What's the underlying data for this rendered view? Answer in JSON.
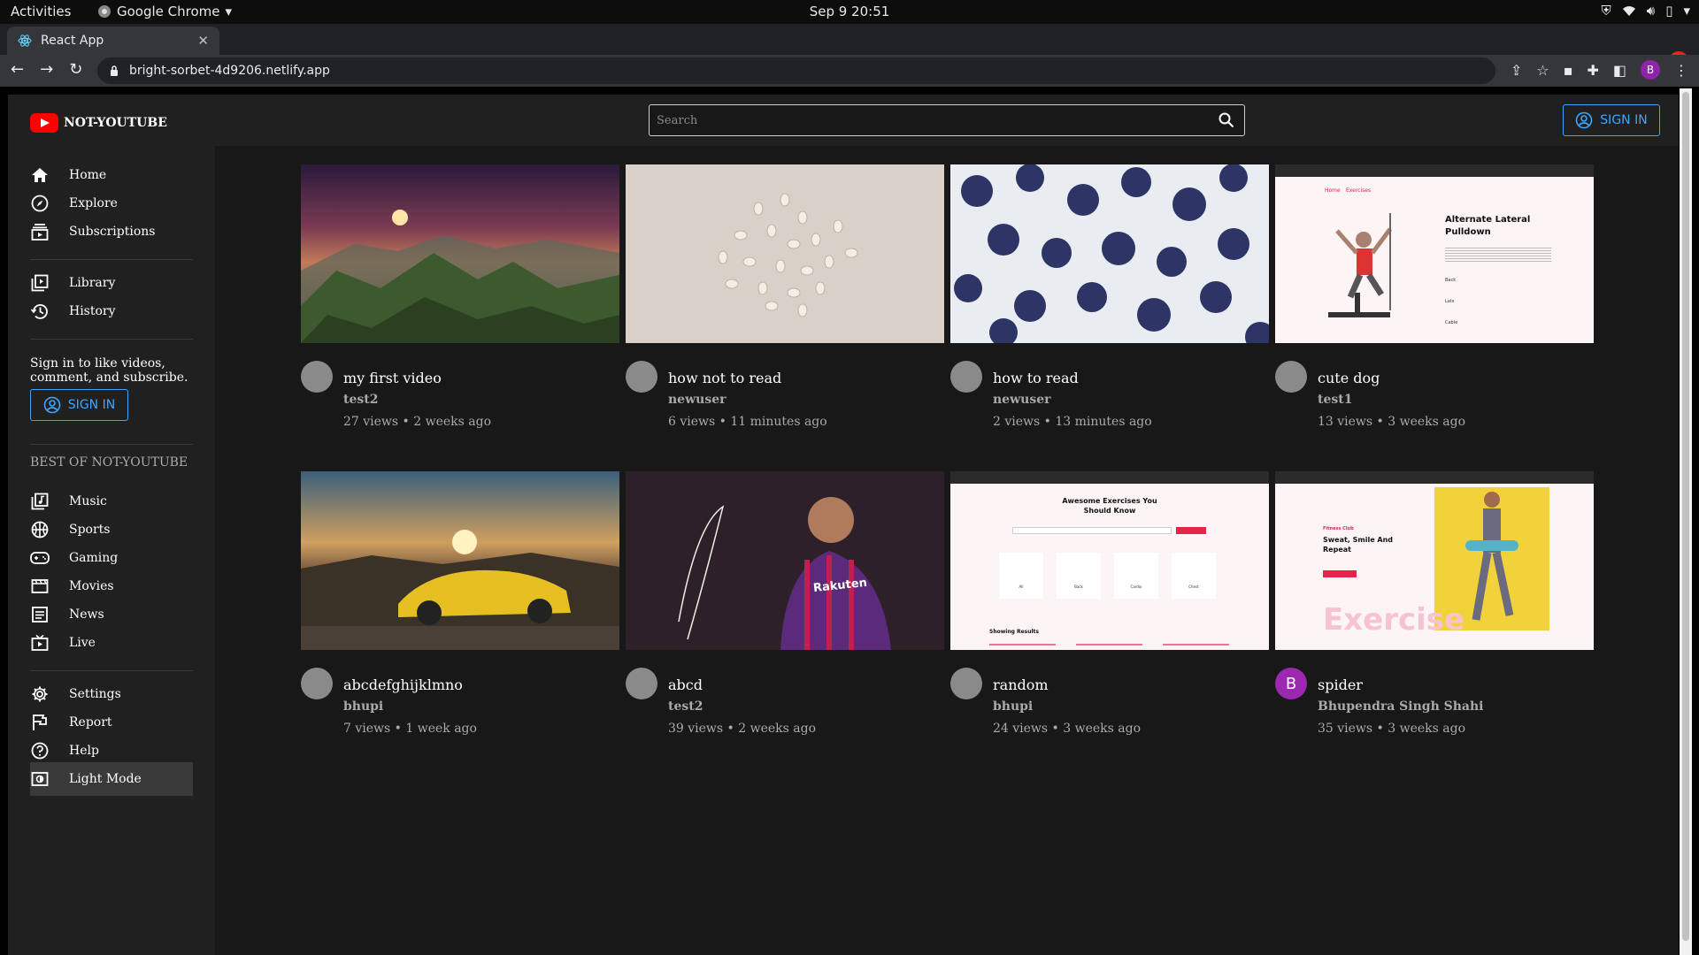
{
  "system": {
    "activities": "Activities",
    "app_name": "Google Chrome",
    "clock": "Sep 9  20:51"
  },
  "browser": {
    "tab_title": "React App",
    "url": "bright-sorbet-4d9206.netlify.app",
    "profile_initial": "B"
  },
  "header": {
    "logo_text": "NOT-YOUTUBE",
    "search_placeholder": "Search",
    "sign_in": "SIGN IN"
  },
  "sidebar": {
    "main": [
      {
        "label": "Home",
        "icon": "home-icon"
      },
      {
        "label": "Explore",
        "icon": "compass-icon"
      },
      {
        "label": "Subscriptions",
        "icon": "subscriptions-icon"
      }
    ],
    "library": [
      {
        "label": "Library",
        "icon": "library-icon"
      },
      {
        "label": "History",
        "icon": "history-icon"
      }
    ],
    "signin_message": "Sign in to like videos, comment, and subscribe.",
    "sign_in": "SIGN IN",
    "best_of_heading": "BEST OF NOT-YOUTUBE",
    "best": [
      {
        "label": "Music",
        "icon": "music-icon"
      },
      {
        "label": "Sports",
        "icon": "sports-icon"
      },
      {
        "label": "Gaming",
        "icon": "gaming-icon"
      },
      {
        "label": "Movies",
        "icon": "movies-icon"
      },
      {
        "label": "News",
        "icon": "news-icon"
      },
      {
        "label": "Live",
        "icon": "live-icon"
      }
    ],
    "footer": [
      {
        "label": "Settings",
        "icon": "gear-icon"
      },
      {
        "label": "Report",
        "icon": "flag-icon"
      },
      {
        "label": "Help",
        "icon": "help-icon"
      },
      {
        "label": "Light Mode",
        "icon": "light-mode-icon"
      }
    ]
  },
  "videos": [
    {
      "title": "my first video",
      "channel": "test2",
      "meta": "27 views • 2 weeks ago",
      "thumb": "mountain-sunset"
    },
    {
      "title": "how not to read",
      "channel": "newuser",
      "meta": "6 views • 11 minutes ago",
      "thumb": "seeds"
    },
    {
      "title": "how to read",
      "channel": "newuser",
      "meta": "2 views • 13 minutes ago",
      "thumb": "blueberries"
    },
    {
      "title": "cute dog",
      "channel": "test1",
      "meta": "13 views • 3 weeks ago",
      "thumb": "exercise-page-pulldown"
    },
    {
      "title": "abcdefghijklmno",
      "channel": "bhupi",
      "meta": "7 views • 1 week ago",
      "thumb": "yellow-car"
    },
    {
      "title": "abcd",
      "channel": "test2",
      "meta": "39 views • 2 weeks ago",
      "thumb": "footballer"
    },
    {
      "title": "random",
      "channel": "bhupi",
      "meta": "24 views • 3 weeks ago",
      "thumb": "exercise-page-search"
    },
    {
      "title": "spider",
      "channel": "Bhupendra Singh Shahi",
      "meta": "35 views • 3 weeks ago",
      "thumb": "fitness-club-page",
      "avatar_letter": "B"
    }
  ],
  "thumb_text": {
    "pulldown_title": "Alternate Lateral Pulldown",
    "pulldown_tags": [
      "Back",
      "Lats",
      "Cable"
    ],
    "nav_home": "Home",
    "nav_exercises": "Exercises",
    "awesome_title": "Awesome Exercises You Should Know",
    "categories": [
      "All",
      "Back",
      "Cardio",
      "Chest"
    ],
    "showing_results": "Showing Results",
    "fitness_club": "Fitness Club",
    "fitness_headline": "Sweat, Smile And Repeat",
    "fitness_watermark": "Exercise",
    "sponsor": "Rakuten"
  },
  "colors": {
    "accent": "#3ea6ff",
    "logo_red": "#ff0000",
    "page_bg": "#181818",
    "panel_bg": "#202020",
    "purple_avatar": "#9c27b0"
  }
}
